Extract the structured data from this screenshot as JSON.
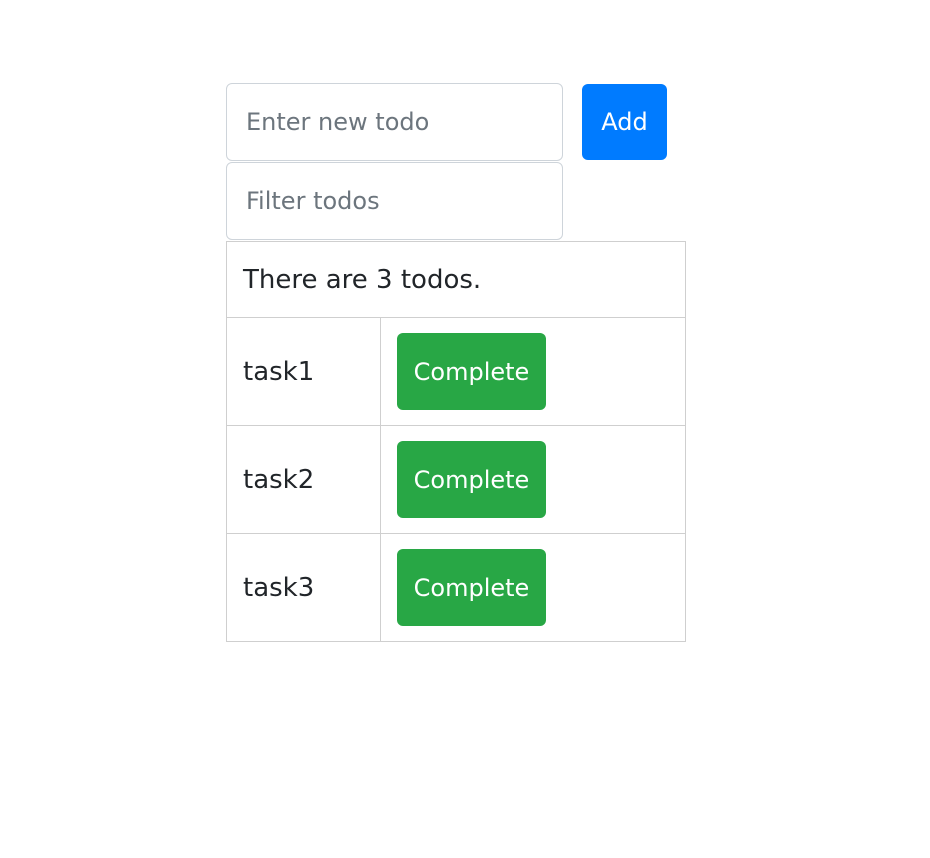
{
  "new_todo": {
    "value": "",
    "placeholder": "Enter new todo",
    "add_label": "Add"
  },
  "filter": {
    "value": "",
    "placeholder": "Filter todos"
  },
  "summary": "There are 3 todos.",
  "todos": [
    {
      "name": "task1",
      "action_label": "Complete"
    },
    {
      "name": "task2",
      "action_label": "Complete"
    },
    {
      "name": "task3",
      "action_label": "Complete"
    }
  ],
  "colors": {
    "add_button": "#007bff",
    "complete_button": "#28a745"
  }
}
